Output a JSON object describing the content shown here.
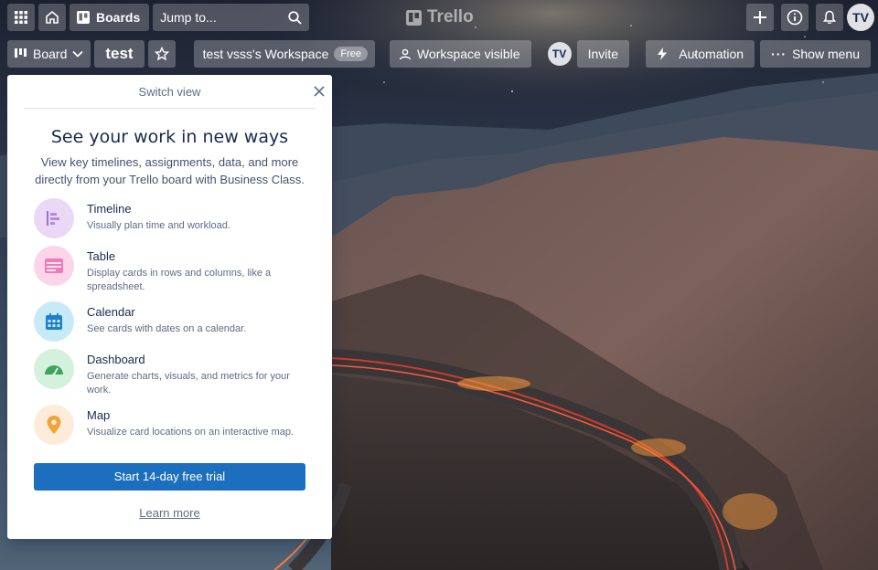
{
  "header": {
    "boards_label": "Boards",
    "search_placeholder": "Jump to...",
    "logo_text": "Trello",
    "avatar_initials": "TV"
  },
  "board": {
    "view_label": "Board",
    "title": "test",
    "workspace_label": "test vsss's Workspace",
    "workspace_badge": "Free",
    "visibility_label": "Workspace visible",
    "member_initials": "TV",
    "invite_label": "Invite",
    "automation_label": "Automation",
    "show_menu_label": "Show menu"
  },
  "popover": {
    "title": "Switch view",
    "heading": "See your work in new ways",
    "subtitle": "View key timelines, assignments, data, and more directly from your Trello board with Business Class.",
    "features": [
      {
        "title": "Timeline",
        "desc": "Visually plan time and workload.",
        "icon": "timeline-icon",
        "color": "#e9d7f5"
      },
      {
        "title": "Table",
        "desc": "Display cards in rows and columns, like a spreadsheet.",
        "icon": "table-icon",
        "color": "#fbd6ea"
      },
      {
        "title": "Calendar",
        "desc": "See cards with dates on a calendar.",
        "icon": "calendar-icon",
        "color": "#c7ecf5"
      },
      {
        "title": "Dashboard",
        "desc": "Generate charts, visuals, and metrics for your work.",
        "icon": "dashboard-icon",
        "color": "#d3f1dc"
      },
      {
        "title": "Map",
        "desc": "Visualize card locations on an interactive map.",
        "icon": "map-pin-icon",
        "color": "#fcecd9"
      }
    ],
    "trial_button": "Start 14-day free trial",
    "learn_more": "Learn more"
  }
}
